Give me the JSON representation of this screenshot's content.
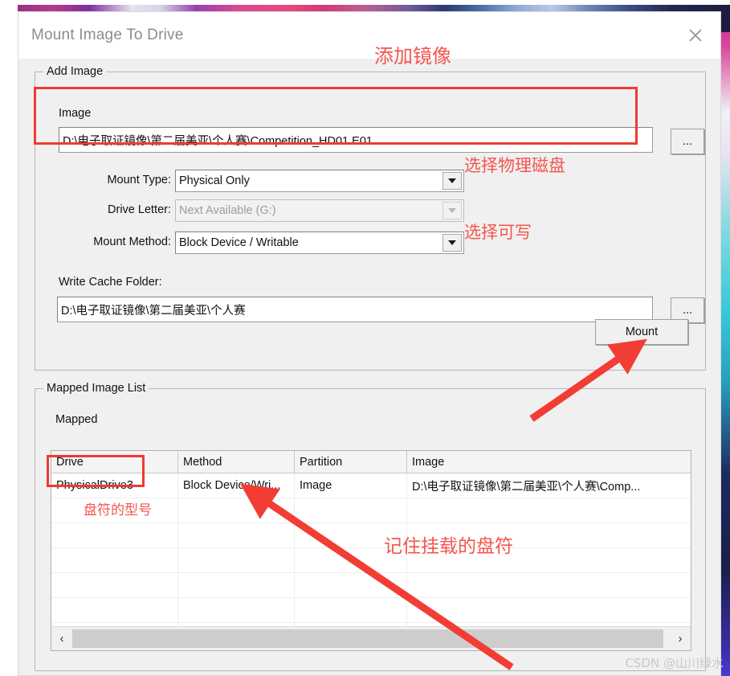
{
  "window": {
    "title": "Mount Image To Drive",
    "close_icon": "close-icon"
  },
  "add_image_group": {
    "legend": "Add Image",
    "image_label": "Image",
    "image_path": "D:\\电子取证镜像\\第二届美亚\\个人赛\\Competition_HD01.E01",
    "image_browse_label": "...",
    "mount_type_label": "Mount Type:",
    "mount_type_value": "Physical Only",
    "drive_letter_label": "Drive Letter:",
    "drive_letter_value": "Next Available (G:)",
    "mount_method_label": "Mount Method:",
    "mount_method_value": "Block Device / Writable",
    "write_cache_label": "Write Cache Folder:",
    "write_cache_value": "D:\\电子取证镜像\\第二届美亚\\个人赛",
    "write_cache_browse_label": "...",
    "mount_button_label": "Mount"
  },
  "mapped_group": {
    "legend": "Mapped Image List",
    "mapped_label": "Mapped",
    "columns": [
      "Drive",
      "Method",
      "Partition",
      "Image"
    ],
    "rows": [
      {
        "drive": "PhysicalDrive3",
        "method": "Block Device/Wri...",
        "partition": "Image",
        "image": "D:\\电子取证镜像\\第二届美亚\\个人赛\\Comp..."
      }
    ],
    "empty_row_count": 7,
    "scroll_left_icon": "chevron-left-icon",
    "scroll_right_icon": "chevron-right-icon"
  },
  "annotations": {
    "add_image": "添加镜像",
    "select_physical_disk": "选择物理磁盘",
    "select_writable": "选择可写",
    "drive_model": "盘符的型号",
    "remember_drive": "记住挂载的盘符"
  },
  "watermark": "CSDN @山川绿水",
  "colors": {
    "annotation_red": "#f4554e",
    "highlight_box_red": "#ee3b33",
    "arrow_red": "#f23d35",
    "dialog_bg": "#f0f0f0",
    "titlebar_bg": "#ffffff",
    "title_text": "#8c8c8c"
  }
}
